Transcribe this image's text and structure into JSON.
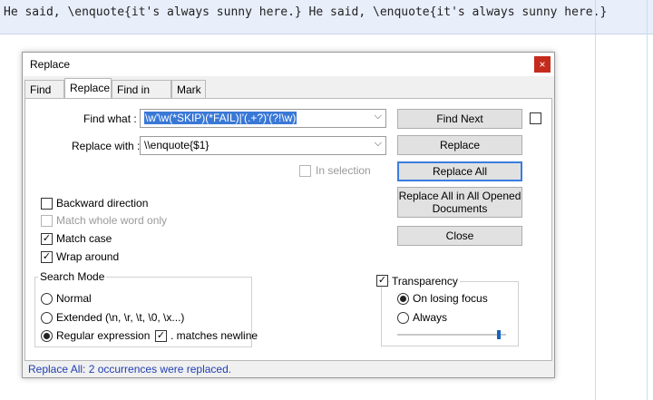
{
  "editor": {
    "line_text": "He said, \\enquote{it's always sunny here.} He said, \\enquote{it's always sunny here.}"
  },
  "dialog": {
    "title": "Replace",
    "close_symbol": "×",
    "tabs": [
      {
        "label": "Find"
      },
      {
        "label": "Replace"
      },
      {
        "label": "Find in Files"
      },
      {
        "label": "Mark"
      }
    ],
    "active_tab": "Replace",
    "find_what_label": "Find what :",
    "find_what_value": "\\w'\\w(*SKIP)(*FAIL)|'(.+?)'(?!\\w)",
    "replace_with_label": "Replace with :",
    "replace_with_value": "\\\\enquote{$1}",
    "in_selection_label": "In selection",
    "buttons": {
      "find_next": "Find Next",
      "replace": "Replace",
      "replace_all": "Replace All",
      "replace_all_opened_line1": "Replace All in All Opened",
      "replace_all_opened_line2": "Documents",
      "close": "Close"
    },
    "options": {
      "backward_direction": "Backward direction",
      "match_whole_word": "Match whole word only",
      "match_case": "Match case",
      "wrap_around": "Wrap around"
    },
    "search_mode": {
      "title": "Search Mode",
      "normal": "Normal",
      "extended": "Extended (\\n, \\r, \\t, \\0, \\x...)",
      "regex": "Regular expression",
      "matches_newline": ". matches newline",
      "selected": "Regular expression"
    },
    "transparency": {
      "label": "Transparency",
      "on_losing_focus": "On losing focus",
      "always": "Always",
      "selected": "On losing focus",
      "slider_level": 0.95
    },
    "status_text": "Replace All: 2 occurrences were replaced."
  }
}
